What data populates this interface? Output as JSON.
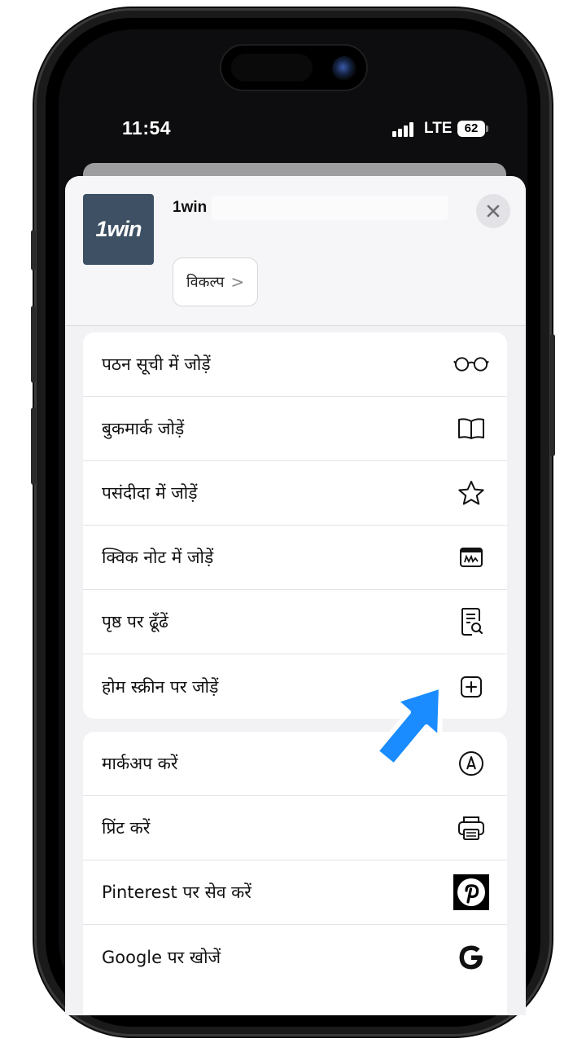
{
  "status_bar": {
    "time": "11:54",
    "network": "LTE",
    "battery": "62"
  },
  "share_sheet": {
    "app_logo_text": "1win",
    "site_title": "1win",
    "options_label": "विकल्प",
    "options_chevron": ">",
    "close_icon": "close-icon"
  },
  "actions_group_1": [
    {
      "label": "पठन सूची में जोड़ें",
      "icon": "glasses-icon"
    },
    {
      "label": "बुकमार्क जोड़ें",
      "icon": "book-icon"
    },
    {
      "label": "पसंदीदा में जोड़ें",
      "icon": "star-icon"
    },
    {
      "label": "क्विक नोट में जोड़ें",
      "icon": "quick-note-icon"
    },
    {
      "label": "पृष्ठ पर ढूँढें",
      "icon": "find-on-page-icon"
    },
    {
      "label": "होम स्क्रीन पर जोड़ें",
      "icon": "add-square-icon"
    }
  ],
  "actions_group_2": [
    {
      "label": "मार्कअप करें",
      "icon": "markup-pen-icon"
    },
    {
      "label": "प्रिंट करें",
      "icon": "printer-icon"
    },
    {
      "label": "Pinterest पर सेव करें",
      "icon": "pinterest-icon"
    },
    {
      "label": "Google पर खोजें",
      "icon": "google-icon"
    }
  ],
  "colors": {
    "pointer": "#1a8cff",
    "sheet_bg": "#f2f2f5",
    "thumb_bg": "#3d5064"
  }
}
